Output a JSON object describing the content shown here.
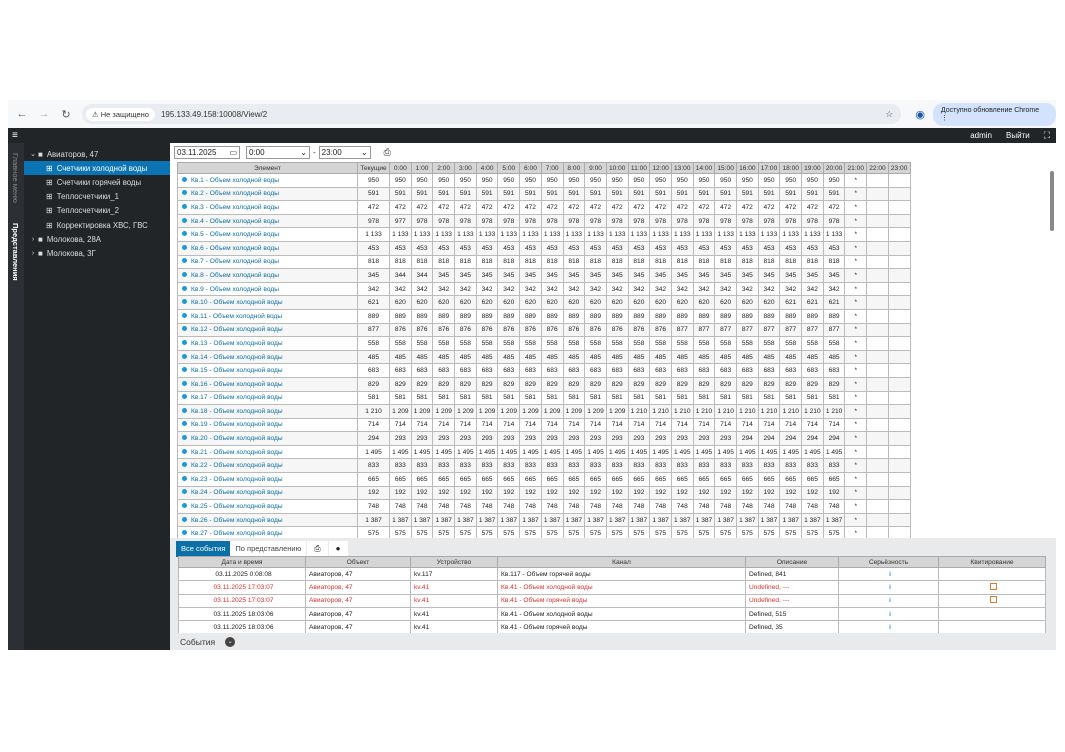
{
  "browser": {
    "insecure": "Не защищено",
    "url": "195.133.49.158:10008/View/2",
    "update": "Доступно обновление Chrome"
  },
  "header": {
    "user": "admin",
    "logout": "Выйти"
  },
  "strip": {
    "main_menu": "Главное меню",
    "views": "Представления"
  },
  "tree": [
    {
      "label": "Авиаторов, 47",
      "level": 0,
      "chev": "⌄",
      "icon": "folder"
    },
    {
      "label": "Счетчики холодной воды",
      "level": 1,
      "icon": "grid",
      "selected": true
    },
    {
      "label": "Счетчики горячей воды",
      "level": 1,
      "icon": "grid"
    },
    {
      "label": "Теплосчетчики_1",
      "level": 1,
      "icon": "grid"
    },
    {
      "label": "Теплосчетчики_2",
      "level": 1,
      "icon": "grid"
    },
    {
      "label": "Корректировка ХВС, ГВС",
      "level": 1,
      "icon": "grid"
    },
    {
      "label": "Молокова, 28А",
      "level": 0,
      "chev": "›",
      "icon": "folder"
    },
    {
      "label": "Молокова, 3Г",
      "level": 0,
      "chev": "›",
      "icon": "folder"
    }
  ],
  "toolbar": {
    "date": "03.11.2025",
    "from": "0:00",
    "to": "23:00",
    "sep": "-"
  },
  "grid": {
    "columns": [
      "Элемент",
      "Текущие",
      "0:00",
      "1:00",
      "2:00",
      "3:00",
      "4:00",
      "5:00",
      "6:00",
      "7:00",
      "8:00",
      "9:00",
      "10:00",
      "11:00",
      "12:00",
      "13:00",
      "14:00",
      "15:00",
      "16:00",
      "17:00",
      "18:00",
      "19:00",
      "20:00",
      "21:00",
      "22:00",
      "23:00"
    ],
    "rows": [
      {
        "label": "Кв.1 - Объем холодной воды",
        "current": "950",
        "values": [
          "950",
          "950",
          "950",
          "950",
          "950",
          "950",
          "950",
          "950",
          "950",
          "950",
          "950",
          "950",
          "950",
          "950",
          "950",
          "950",
          "950",
          "950",
          "950",
          "950",
          "950",
          "*",
          "",
          ""
        ]
      },
      {
        "label": "Кв.2 - Объем холодной воды",
        "current": "591",
        "values": [
          "591",
          "591",
          "591",
          "591",
          "591",
          "591",
          "591",
          "591",
          "591",
          "591",
          "591",
          "591",
          "591",
          "591",
          "591",
          "591",
          "591",
          "591",
          "591",
          "591",
          "591",
          "*",
          "",
          ""
        ]
      },
      {
        "label": "Кв.3 - Объем холодной воды",
        "current": "472",
        "values": [
          "472",
          "472",
          "472",
          "472",
          "472",
          "472",
          "472",
          "472",
          "472",
          "472",
          "472",
          "472",
          "472",
          "472",
          "472",
          "472",
          "472",
          "472",
          "472",
          "472",
          "472",
          "*",
          "",
          ""
        ]
      },
      {
        "label": "Кв.4 - Объем холодной воды",
        "current": "978",
        "values": [
          "977",
          "978",
          "978",
          "978",
          "978",
          "978",
          "978",
          "978",
          "978",
          "978",
          "978",
          "978",
          "978",
          "978",
          "978",
          "978",
          "978",
          "978",
          "978",
          "978",
          "978",
          "*",
          "",
          ""
        ]
      },
      {
        "label": "Кв.5 - Объем холодной воды",
        "current": "1 133",
        "values": [
          "1 133",
          "1 133",
          "1 133",
          "1 133",
          "1 133",
          "1 133",
          "1 133",
          "1 133",
          "1 133",
          "1 133",
          "1 133",
          "1 133",
          "1 133",
          "1 133",
          "1 133",
          "1 133",
          "1 133",
          "1 133",
          "1 133",
          "1 133",
          "1 133",
          "*",
          "",
          ""
        ]
      },
      {
        "label": "Кв.6 - Объем холодной воды",
        "current": "453",
        "values": [
          "453",
          "453",
          "453",
          "453",
          "453",
          "453",
          "453",
          "453",
          "453",
          "453",
          "453",
          "453",
          "453",
          "453",
          "453",
          "453",
          "453",
          "453",
          "453",
          "453",
          "453",
          "*",
          "",
          ""
        ]
      },
      {
        "label": "Кв.7 - Объем холодной воды",
        "current": "818",
        "values": [
          "818",
          "818",
          "818",
          "818",
          "818",
          "818",
          "818",
          "818",
          "818",
          "818",
          "818",
          "818",
          "818",
          "818",
          "818",
          "818",
          "818",
          "818",
          "818",
          "818",
          "818",
          "*",
          "",
          ""
        ]
      },
      {
        "label": "Кв.8 - Объем холодной воды",
        "current": "345",
        "values": [
          "344",
          "344",
          "345",
          "345",
          "345",
          "345",
          "345",
          "345",
          "345",
          "345",
          "345",
          "345",
          "345",
          "345",
          "345",
          "345",
          "345",
          "345",
          "345",
          "345",
          "345",
          "*",
          "",
          ""
        ]
      },
      {
        "label": "Кв.9 - Объем холодной воды",
        "current": "342",
        "values": [
          "342",
          "342",
          "342",
          "342",
          "342",
          "342",
          "342",
          "342",
          "342",
          "342",
          "342",
          "342",
          "342",
          "342",
          "342",
          "342",
          "342",
          "342",
          "342",
          "342",
          "342",
          "*",
          "",
          ""
        ]
      },
      {
        "label": "Кв.10 - Объем холодной воды",
        "current": "621",
        "values": [
          "620",
          "620",
          "620",
          "620",
          "620",
          "620",
          "620",
          "620",
          "620",
          "620",
          "620",
          "620",
          "620",
          "620",
          "620",
          "620",
          "620",
          "620",
          "621",
          "621",
          "621",
          "*",
          "",
          ""
        ]
      },
      {
        "label": "Кв.11 - Объем холодной воды",
        "current": "889",
        "values": [
          "889",
          "889",
          "889",
          "889",
          "889",
          "889",
          "889",
          "889",
          "889",
          "889",
          "889",
          "889",
          "889",
          "889",
          "889",
          "889",
          "889",
          "889",
          "889",
          "889",
          "889",
          "*",
          "",
          ""
        ]
      },
      {
        "label": "Кв.12 - Объем холодной воды",
        "current": "877",
        "values": [
          "876",
          "876",
          "876",
          "876",
          "876",
          "876",
          "876",
          "876",
          "876",
          "876",
          "876",
          "876",
          "876",
          "877",
          "877",
          "877",
          "877",
          "877",
          "877",
          "877",
          "877",
          "*",
          "",
          ""
        ]
      },
      {
        "label": "Кв.13 - Объем холодной воды",
        "current": "558",
        "values": [
          "558",
          "558",
          "558",
          "558",
          "558",
          "558",
          "558",
          "558",
          "558",
          "558",
          "558",
          "558",
          "558",
          "558",
          "558",
          "558",
          "558",
          "558",
          "558",
          "558",
          "558",
          "*",
          "",
          ""
        ]
      },
      {
        "label": "Кв.14 - Объем холодной воды",
        "current": "485",
        "values": [
          "485",
          "485",
          "485",
          "485",
          "485",
          "485",
          "485",
          "485",
          "485",
          "485",
          "485",
          "485",
          "485",
          "485",
          "485",
          "485",
          "485",
          "485",
          "485",
          "485",
          "485",
          "*",
          "",
          ""
        ]
      },
      {
        "label": "Кв.15 - Объем холодной воды",
        "current": "683",
        "values": [
          "683",
          "683",
          "683",
          "683",
          "683",
          "683",
          "683",
          "683",
          "683",
          "683",
          "683",
          "683",
          "683",
          "683",
          "683",
          "683",
          "683",
          "683",
          "683",
          "683",
          "683",
          "*",
          "",
          ""
        ]
      },
      {
        "label": "Кв.16 - Объем холодной воды",
        "current": "829",
        "values": [
          "829",
          "829",
          "829",
          "829",
          "829",
          "829",
          "829",
          "829",
          "829",
          "829",
          "829",
          "829",
          "829",
          "829",
          "829",
          "829",
          "829",
          "829",
          "829",
          "829",
          "829",
          "*",
          "",
          ""
        ]
      },
      {
        "label": "Кв.17 - Объем холодной воды",
        "current": "581",
        "values": [
          "581",
          "581",
          "581",
          "581",
          "581",
          "581",
          "581",
          "581",
          "581",
          "581",
          "581",
          "581",
          "581",
          "581",
          "581",
          "581",
          "581",
          "581",
          "581",
          "581",
          "581",
          "*",
          "",
          ""
        ]
      },
      {
        "label": "Кв.18 - Объем холодной воды",
        "current": "1 210",
        "values": [
          "1 209",
          "1 209",
          "1 209",
          "1 209",
          "1 209",
          "1 209",
          "1 209",
          "1 209",
          "1 209",
          "1 209",
          "1 209",
          "1 210",
          "1 210",
          "1 210",
          "1 210",
          "1 210",
          "1 210",
          "1 210",
          "1 210",
          "1 210",
          "1 210",
          "*",
          "",
          ""
        ]
      },
      {
        "label": "Кв.19 - Объем холодной воды",
        "current": "714",
        "values": [
          "714",
          "714",
          "714",
          "714",
          "714",
          "714",
          "714",
          "714",
          "714",
          "714",
          "714",
          "714",
          "714",
          "714",
          "714",
          "714",
          "714",
          "714",
          "714",
          "714",
          "714",
          "*",
          "",
          ""
        ]
      },
      {
        "label": "Кв.20 - Объем холодной воды",
        "current": "294",
        "values": [
          "293",
          "293",
          "293",
          "293",
          "293",
          "293",
          "293",
          "293",
          "293",
          "293",
          "293",
          "293",
          "293",
          "293",
          "293",
          "293",
          "294",
          "294",
          "294",
          "294",
          "294",
          "*",
          "",
          ""
        ]
      },
      {
        "label": "Кв.21 - Объем холодной воды",
        "current": "1 495",
        "values": [
          "1 495",
          "1 495",
          "1 495",
          "1 495",
          "1 495",
          "1 495",
          "1 495",
          "1 495",
          "1 495",
          "1 495",
          "1 495",
          "1 495",
          "1 495",
          "1 495",
          "1 495",
          "1 495",
          "1 495",
          "1 495",
          "1 495",
          "1 495",
          "1 495",
          "*",
          "",
          ""
        ]
      },
      {
        "label": "Кв.22 - Объем холодной воды",
        "current": "833",
        "values": [
          "833",
          "833",
          "833",
          "833",
          "833",
          "833",
          "833",
          "833",
          "833",
          "833",
          "833",
          "833",
          "833",
          "833",
          "833",
          "833",
          "833",
          "833",
          "833",
          "833",
          "833",
          "*",
          "",
          ""
        ]
      },
      {
        "label": "Кв.23 - Объем холодной воды",
        "current": "665",
        "values": [
          "665",
          "665",
          "665",
          "665",
          "665",
          "665",
          "665",
          "665",
          "665",
          "665",
          "665",
          "665",
          "665",
          "665",
          "665",
          "665",
          "665",
          "665",
          "665",
          "665",
          "665",
          "*",
          "",
          ""
        ]
      },
      {
        "label": "Кв.24 - Объем холодной воды",
        "current": "192",
        "values": [
          "192",
          "192",
          "192",
          "192",
          "192",
          "192",
          "192",
          "192",
          "192",
          "192",
          "192",
          "192",
          "192",
          "192",
          "192",
          "192",
          "192",
          "192",
          "192",
          "192",
          "192",
          "*",
          "",
          ""
        ]
      },
      {
        "label": "Кв.25 - Объем холодной воды",
        "current": "748",
        "values": [
          "748",
          "748",
          "748",
          "748",
          "748",
          "748",
          "748",
          "748",
          "748",
          "748",
          "748",
          "748",
          "748",
          "748",
          "748",
          "748",
          "748",
          "748",
          "748",
          "748",
          "748",
          "*",
          "",
          ""
        ]
      },
      {
        "label": "Кв.26 - Объем холодной воды",
        "current": "1 387",
        "values": [
          "1 387",
          "1 387",
          "1 387",
          "1 387",
          "1 387",
          "1 387",
          "1 387",
          "1 387",
          "1 387",
          "1 387",
          "1 387",
          "1 387",
          "1 387",
          "1 387",
          "1 387",
          "1 387",
          "1 387",
          "1 387",
          "1 387",
          "1 387",
          "1 387",
          "*",
          "",
          ""
        ]
      },
      {
        "label": "Кв.27 - Объем холодной воды",
        "current": "575",
        "values": [
          "575",
          "575",
          "575",
          "575",
          "575",
          "575",
          "575",
          "575",
          "575",
          "575",
          "575",
          "575",
          "575",
          "575",
          "575",
          "575",
          "575",
          "575",
          "575",
          "575",
          "575",
          "*",
          "",
          ""
        ]
      }
    ]
  },
  "events": {
    "tabs": [
      "Все события",
      "По представлению"
    ],
    "columns": [
      "Дата и время",
      "Объект",
      "Устройство",
      "Канал",
      "Описание",
      "Серьёзность",
      "Квитирование"
    ],
    "rows": [
      {
        "datetime": "03.11.2025 0:08:08",
        "object": "Авиаторов, 47",
        "device": "kv.117",
        "channel": "Кв.117 - Объем горячей воды",
        "description": "Defined, 841",
        "severity": "i",
        "ack": false,
        "alarm": false
      },
      {
        "datetime": "03.11.2025 17:03:07",
        "object": "Авиаторов, 47",
        "device": "kv.41",
        "channel": "Кв.41 - Объем холодной воды",
        "description": "Undefined, ---",
        "severity": "i",
        "ack": true,
        "alarm": true
      },
      {
        "datetime": "03.11.2025 17:03:07",
        "object": "Авиаторов, 47",
        "device": "kv.41",
        "channel": "Кв.41 - Объем горячей воды",
        "description": "Undefined, ---",
        "severity": "i",
        "ack": true,
        "alarm": true
      },
      {
        "datetime": "03.11.2025 18:03:06",
        "object": "Авиаторов, 47",
        "device": "kv.41",
        "channel": "Кв.41 - Объем холодной воды",
        "description": "Defined, 515",
        "severity": "i",
        "ack": false,
        "alarm": false
      },
      {
        "datetime": "03.11.2025 18:03:06",
        "object": "Авиаторов, 47",
        "device": "kv.41",
        "channel": "Кв.41 - Объем горячей воды",
        "description": "Defined, 35",
        "severity": "i",
        "ack": false,
        "alarm": false
      }
    ],
    "footer": "События"
  }
}
